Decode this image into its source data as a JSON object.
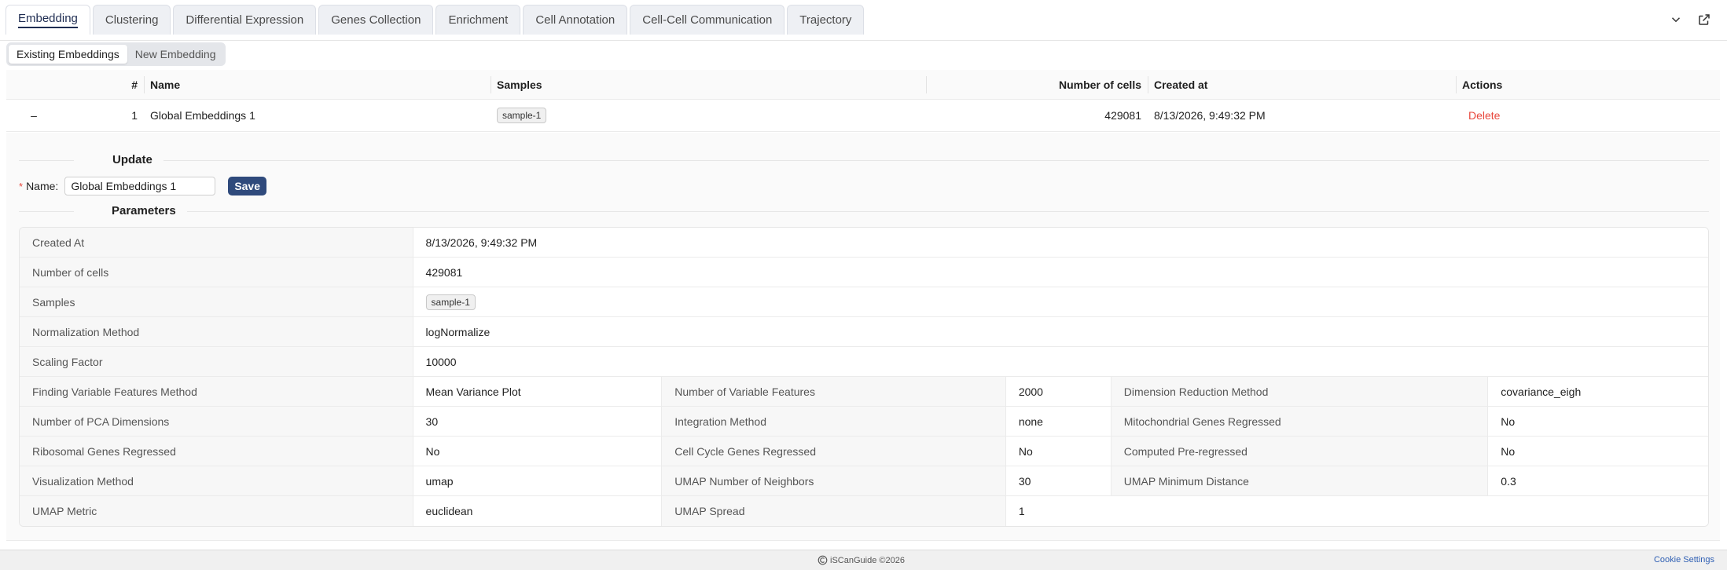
{
  "tabs": [
    {
      "label": "Embedding",
      "active": true
    },
    {
      "label": "Clustering"
    },
    {
      "label": "Differential Expression"
    },
    {
      "label": "Genes Collection"
    },
    {
      "label": "Enrichment"
    },
    {
      "label": "Cell Annotation"
    },
    {
      "label": "Cell-Cell Communication"
    },
    {
      "label": "Trajectory"
    }
  ],
  "toolbar_icons": [
    "chevron-down-icon",
    "open-external-icon"
  ],
  "segmented": {
    "existing": "Existing Embeddings",
    "new": "New Embedding"
  },
  "table": {
    "headers": {
      "num": "#",
      "name": "Name",
      "samples": "Samples",
      "cells": "Number of cells",
      "created": "Created at",
      "actions": "Actions"
    },
    "rows": [
      {
        "expand": "–",
        "num": "1",
        "name": "Global Embeddings 1",
        "sample": "sample-1",
        "cells": "429081",
        "created": "8/13/2026, 9:49:32 PM",
        "action": "Delete"
      }
    ]
  },
  "update": {
    "section_title": "Update",
    "name_label": "Name",
    "name_value": "Global Embeddings 1",
    "save_label": "Save"
  },
  "parameters": {
    "section_title": "Parameters",
    "created_at": {
      "label": "Created At",
      "value": "8/13/2026, 9:49:32 PM"
    },
    "num_cells": {
      "label": "Number of cells",
      "value": "429081"
    },
    "samples": {
      "label": "Samples",
      "value": "sample-1"
    },
    "normalization": {
      "label": "Normalization Method",
      "value": "logNormalize"
    },
    "scaling": {
      "label": "Scaling Factor",
      "value": "10000"
    },
    "grid": [
      [
        {
          "label": "Finding Variable Features Method",
          "value": "Mean Variance Plot"
        },
        {
          "label": "Number of Variable Features",
          "value": "2000"
        },
        {
          "label": "Dimension Reduction Method",
          "value": "covariance_eigh"
        }
      ],
      [
        {
          "label": "Number of PCA Dimensions",
          "value": "30"
        },
        {
          "label": "Integration Method",
          "value": "none"
        },
        {
          "label": "Mitochondrial Genes Regressed",
          "value": "No"
        }
      ],
      [
        {
          "label": "Ribosomal Genes Regressed",
          "value": "No"
        },
        {
          "label": "Cell Cycle Genes Regressed",
          "value": "No"
        },
        {
          "label": "Computed Pre-regressed",
          "value": "No"
        }
      ],
      [
        {
          "label": "Visualization Method",
          "value": "umap"
        },
        {
          "label": "UMAP Number of Neighbors",
          "value": "30"
        },
        {
          "label": "UMAP Minimum Distance",
          "value": "0.3"
        }
      ],
      [
        {
          "label": "UMAP Metric",
          "value": "euclidean"
        },
        {
          "label": "UMAP Spread",
          "value": "1"
        }
      ]
    ]
  },
  "footer": {
    "brand": "iSCanGuide ©2026",
    "cookie": "Cookie Settings"
  }
}
